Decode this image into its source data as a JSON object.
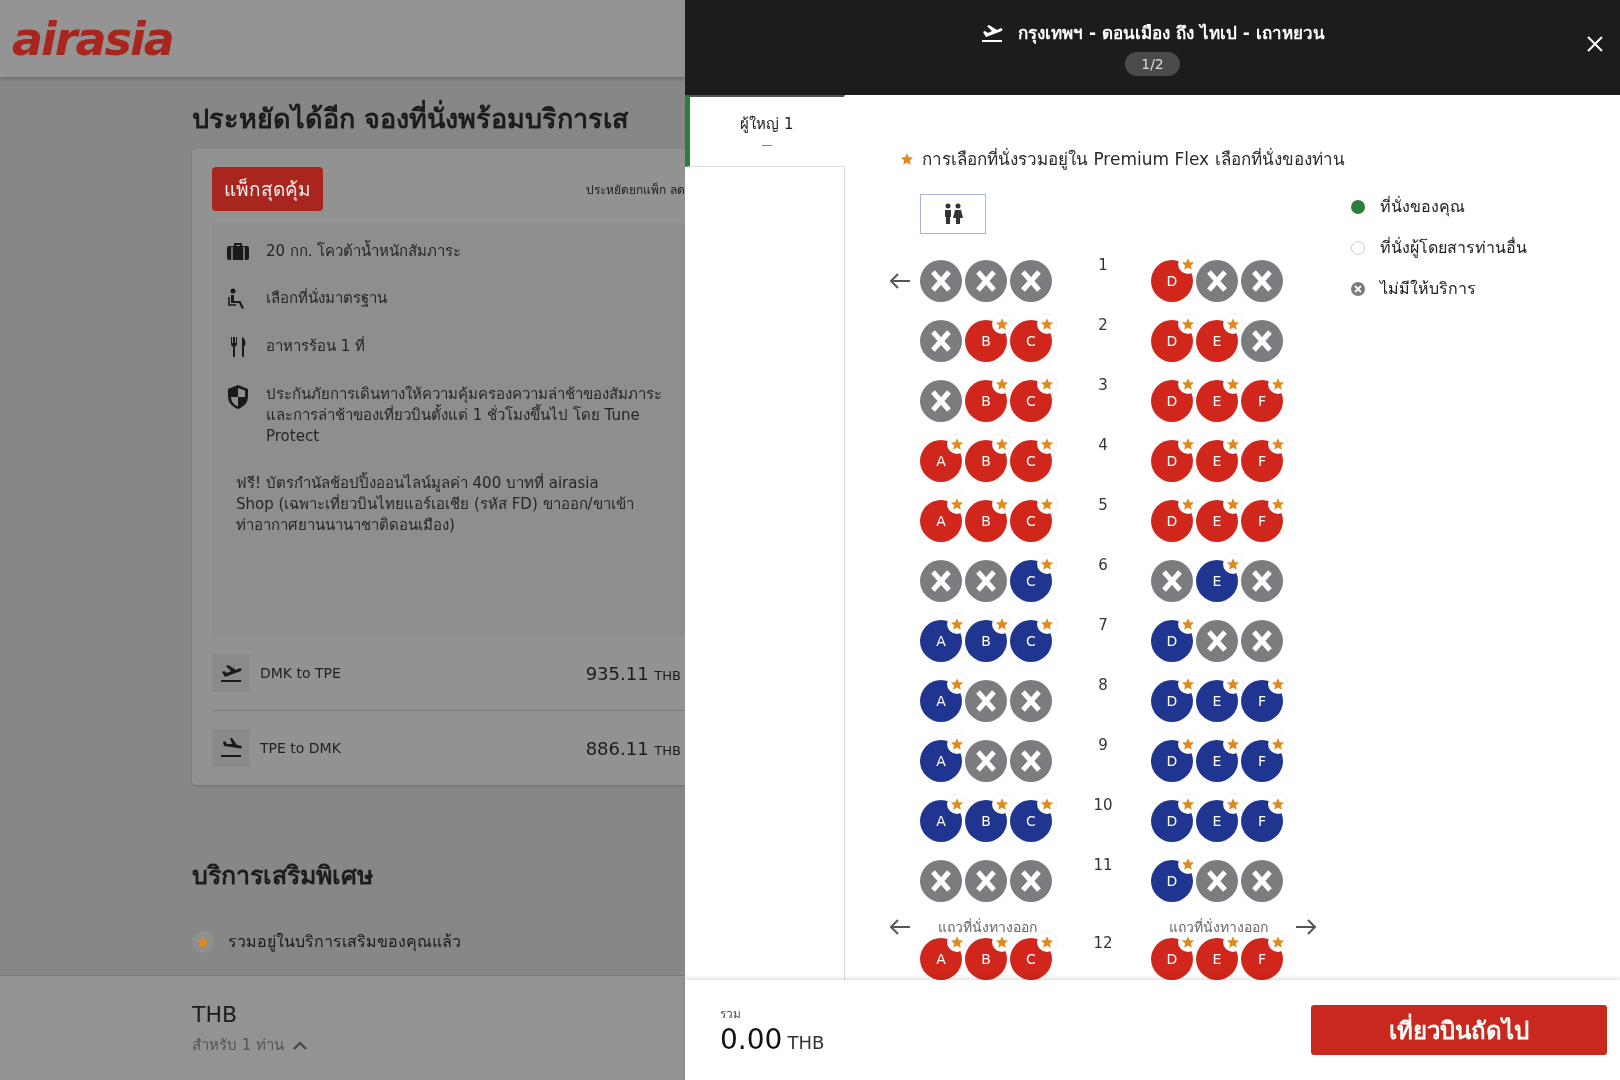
{
  "background_page": {
    "logo": "airasia",
    "heading": "ประหยัดได้อีก จองที่นั่งพร้อมบริการเส",
    "package": {
      "badge": "แพ็กสุดคุ้ม",
      "note": "ประหยัดยกแพ็ก ลด",
      "features": [
        {
          "kind": "baggage",
          "text": "20 กก. โควต้าน้ำหนักสัมภาระ"
        },
        {
          "kind": "seat",
          "text": "เลือกที่นั่งมาตรฐาน"
        },
        {
          "kind": "meal",
          "text": "อาหารร้อน 1 ที่"
        },
        {
          "kind": "insurance",
          "text": "ประกันภัยการเดินทางให้ความคุ้มครองความล่าช้าของสัมภาระและการล่าช้าของเที่ยวบินตั้งแต่ 1 ชั่วโมงขึ้นไป โดย Tune Protect"
        }
      ],
      "promo": "ฟรี! บัตรกำนัลช้อปปิ้งออนไลน์มูลค่า 400 บาทที่ airasia Shop (เฉพาะเที่ยวบินไทยแอร์เอเชีย (รหัส FD) ขาออก/ขาเข้าท่าอากาศยานนานาชาติดอนเมือง)"
    },
    "flights": [
      {
        "kind": "depart",
        "route": "DMK to TPE",
        "price": "935.11",
        "currency": "THB"
      },
      {
        "kind": "return",
        "route": "TPE to DMK",
        "price": "886.11",
        "currency": "THB"
      }
    ],
    "addons_heading": "บริการเสริมพิเศษ",
    "included_note": "รวมอยู่ในบริการเสริมของคุณแล้ว",
    "footer": {
      "currency": "THB",
      "passengers": "สำหรับ 1 ท่าน"
    }
  },
  "seat_modal": {
    "route": "กรุงเทพฯ - ดอนเมือง ถึง ไทเป - เถาหยวน",
    "step": "1/2",
    "passengers": [
      {
        "label": "ผู้ใหญ่ 1",
        "seat": "—",
        "selected": true
      }
    ],
    "note": "การเลือกที่นั่งรวมอยู่ใน Premium Flex เลือกที่นั่งของท่าน",
    "legend": [
      {
        "kind": "mine",
        "label": "ที่นั่งของคุณ"
      },
      {
        "kind": "other",
        "label": "ที่นั่งผู้โดยสารท่านอื่น"
      },
      {
        "kind": "unavailable",
        "label": "ไม่มีให้บริการ"
      }
    ],
    "rows": [
      {
        "number": "1",
        "left": [
          {
            "kind": "blocked"
          },
          {
            "kind": "blocked"
          },
          {
            "kind": "blocked"
          }
        ],
        "right": [
          {
            "kind": "seat",
            "letter": "D",
            "color": "#d0261c",
            "star": true
          },
          {
            "kind": "blocked"
          },
          {
            "kind": "blocked"
          }
        ]
      },
      {
        "number": "2",
        "left": [
          {
            "kind": "blocked"
          },
          {
            "kind": "seat",
            "letter": "B",
            "color": "#d0261c",
            "star": true
          },
          {
            "kind": "seat",
            "letter": "C",
            "color": "#d0261c",
            "star": true
          }
        ],
        "right": [
          {
            "kind": "seat",
            "letter": "D",
            "color": "#d0261c",
            "star": true
          },
          {
            "kind": "seat",
            "letter": "E",
            "color": "#d0261c",
            "star": true
          },
          {
            "kind": "blocked"
          }
        ]
      },
      {
        "number": "3",
        "left": [
          {
            "kind": "blocked"
          },
          {
            "kind": "seat",
            "letter": "B",
            "color": "#d0261c",
            "star": true
          },
          {
            "kind": "seat",
            "letter": "C",
            "color": "#d0261c",
            "star": true
          }
        ],
        "right": [
          {
            "kind": "seat",
            "letter": "D",
            "color": "#d0261c",
            "star": true
          },
          {
            "kind": "seat",
            "letter": "E",
            "color": "#d0261c",
            "star": true
          },
          {
            "kind": "seat",
            "letter": "F",
            "color": "#d0261c",
            "star": true
          }
        ]
      },
      {
        "number": "4",
        "left": [
          {
            "kind": "seat",
            "letter": "A",
            "color": "#d0261c",
            "star": true
          },
          {
            "kind": "seat",
            "letter": "B",
            "color": "#d0261c",
            "star": true
          },
          {
            "kind": "seat",
            "letter": "C",
            "color": "#d0261c",
            "star": true
          }
        ],
        "right": [
          {
            "kind": "seat",
            "letter": "D",
            "color": "#d0261c",
            "star": true
          },
          {
            "kind": "seat",
            "letter": "E",
            "color": "#d0261c",
            "star": true
          },
          {
            "kind": "seat",
            "letter": "F",
            "color": "#d0261c",
            "star": true
          }
        ]
      },
      {
        "number": "5",
        "left": [
          {
            "kind": "seat",
            "letter": "A",
            "color": "#d0261c",
            "star": true
          },
          {
            "kind": "seat",
            "letter": "B",
            "color": "#d0261c",
            "star": true
          },
          {
            "kind": "seat",
            "letter": "C",
            "color": "#d0261c",
            "star": true
          }
        ],
        "right": [
          {
            "kind": "seat",
            "letter": "D",
            "color": "#d0261c",
            "star": true
          },
          {
            "kind": "seat",
            "letter": "E",
            "color": "#d0261c",
            "star": true
          },
          {
            "kind": "seat",
            "letter": "F",
            "color": "#d0261c",
            "star": true
          }
        ]
      },
      {
        "number": "6",
        "left": [
          {
            "kind": "blocked"
          },
          {
            "kind": "blocked"
          },
          {
            "kind": "seat",
            "letter": "C",
            "color": "#1f3590",
            "star": true
          }
        ],
        "right": [
          {
            "kind": "blocked"
          },
          {
            "kind": "seat",
            "letter": "E",
            "color": "#1f3590",
            "star": true
          },
          {
            "kind": "blocked"
          }
        ]
      },
      {
        "number": "7",
        "left": [
          {
            "kind": "seat",
            "letter": "A",
            "color": "#1f3590",
            "star": true
          },
          {
            "kind": "seat",
            "letter": "B",
            "color": "#1f3590",
            "star": true
          },
          {
            "kind": "seat",
            "letter": "C",
            "color": "#1f3590",
            "star": true
          }
        ],
        "right": [
          {
            "kind": "seat",
            "letter": "D",
            "color": "#1f3590",
            "star": true
          },
          {
            "kind": "blocked"
          },
          {
            "kind": "blocked"
          }
        ]
      },
      {
        "number": "8",
        "left": [
          {
            "kind": "seat",
            "letter": "A",
            "color": "#1f3590",
            "star": true
          },
          {
            "kind": "blocked"
          },
          {
            "kind": "blocked"
          }
        ],
        "right": [
          {
            "kind": "seat",
            "letter": "D",
            "color": "#1f3590",
            "star": true
          },
          {
            "kind": "seat",
            "letter": "E",
            "color": "#1f3590",
            "star": true
          },
          {
            "kind": "seat",
            "letter": "F",
            "color": "#1f3590",
            "star": true
          }
        ]
      },
      {
        "number": "9",
        "left": [
          {
            "kind": "seat",
            "letter": "A",
            "color": "#1f3590",
            "star": true
          },
          {
            "kind": "blocked"
          },
          {
            "kind": "blocked"
          }
        ],
        "right": [
          {
            "kind": "seat",
            "letter": "D",
            "color": "#1f3590",
            "star": true
          },
          {
            "kind": "seat",
            "letter": "E",
            "color": "#1f3590",
            "star": true
          },
          {
            "kind": "seat",
            "letter": "F",
            "color": "#1f3590",
            "star": true
          }
        ]
      },
      {
        "number": "10",
        "left": [
          {
            "kind": "seat",
            "letter": "A",
            "color": "#1f3590",
            "star": true
          },
          {
            "kind": "seat",
            "letter": "B",
            "color": "#1f3590",
            "star": true
          },
          {
            "kind": "seat",
            "letter": "C",
            "color": "#1f3590",
            "star": true
          }
        ],
        "right": [
          {
            "kind": "seat",
            "letter": "D",
            "color": "#1f3590",
            "star": true
          },
          {
            "kind": "seat",
            "letter": "E",
            "color": "#1f3590",
            "star": true
          },
          {
            "kind": "seat",
            "letter": "F",
            "color": "#1f3590",
            "star": true
          }
        ]
      },
      {
        "number": "11",
        "left": [
          {
            "kind": "blocked"
          },
          {
            "kind": "blocked"
          },
          {
            "kind": "blocked"
          }
        ],
        "right": [
          {
            "kind": "seat",
            "letter": "D",
            "color": "#1f3590",
            "star": true
          },
          {
            "kind": "blocked"
          },
          {
            "kind": "blocked"
          }
        ]
      },
      {
        "number": "12",
        "exit_labels": [
          "แถวที่นั่งทางออก",
          "แถวที่นั่งทางออก"
        ],
        "left": [
          {
            "kind": "seat",
            "letter": "A",
            "color": "#d0261c",
            "star": true
          },
          {
            "kind": "seat",
            "letter": "B",
            "color": "#d0261c",
            "star": true
          },
          {
            "kind": "seat",
            "letter": "C",
            "color": "#d0261c",
            "star": true
          }
        ],
        "right": [
          {
            "kind": "seat",
            "letter": "D",
            "color": "#d0261c",
            "star": true
          },
          {
            "kind": "seat",
            "letter": "E",
            "color": "#d0261c",
            "star": true
          },
          {
            "kind": "seat",
            "letter": "F",
            "color": "#d0261c",
            "star": true
          }
        ]
      }
    ],
    "total_label": "รวม",
    "total": "0.00",
    "currency": "THB",
    "next_button": "เที่ยวบินถัดไป"
  }
}
